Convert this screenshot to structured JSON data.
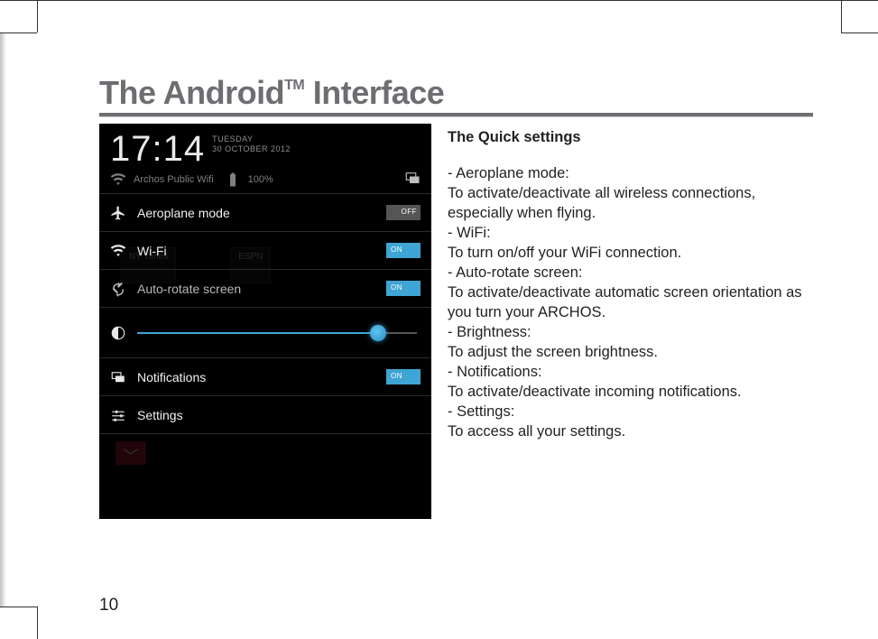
{
  "doc": {
    "title_part1": "The Android",
    "title_tm": "TM",
    "title_part2": " Interface",
    "page_number": "10"
  },
  "text": {
    "heading": "The Quick settings",
    "items": [
      {
        "title": "Aeroplane mode:",
        "desc": "To activate/deactivate all wireless connections, especially when flying."
      },
      {
        "title": "WiFi:",
        "desc": "To turn on/off your WiFi connection."
      },
      {
        "title": "Auto-rotate screen:",
        "desc": "To activate/deactivate automatic screen orientation as you turn your ARCHOS."
      },
      {
        "title": "Brightness:",
        "desc": "To adjust the screen brightness."
      },
      {
        "title": "Notifications:",
        "desc": "To activate/deactivate incoming notifications."
      },
      {
        "title": "Settings:",
        "desc": "To access all your settings."
      }
    ]
  },
  "phone": {
    "time": "17:14",
    "day": "TUESDAY",
    "date": "30 OCTOBER 2012",
    "ssid": "Archos Public Wifi",
    "battery": "100%",
    "rows": {
      "aeroplane": {
        "label": "Aeroplane mode",
        "toggle": "OFF"
      },
      "wifi": {
        "label": "Wi-Fi",
        "toggle": "ON"
      },
      "autorotate": {
        "label": "Auto-rotate screen",
        "toggle": "ON"
      },
      "notifications": {
        "label": "Notifications",
        "toggle": "ON"
      },
      "settings": {
        "label": "Settings"
      }
    },
    "bg_apps": {
      "left": "NY Times",
      "right": "ESPN"
    }
  }
}
